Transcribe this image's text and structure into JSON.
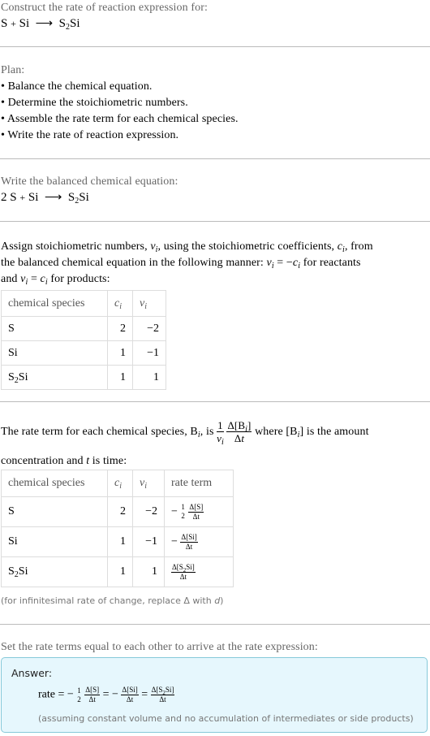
{
  "intro": {
    "prompt": "Construct the rate of reaction expression for:",
    "reaction": {
      "reactants": [
        "S",
        "Si"
      ],
      "arrow": "⟶",
      "product_base": "S",
      "product_sub": "2",
      "product_rest": "Si",
      "plus": "+"
    }
  },
  "plan": {
    "title": "Plan:",
    "items": [
      "• Balance the chemical equation.",
      "• Determine the stoichiometric numbers.",
      "• Assemble the rate term for each chemical species.",
      "• Write the rate of reaction expression."
    ]
  },
  "balanced": {
    "title": "Write the balanced chemical equation:",
    "coef": "2",
    "reactant1": "S",
    "plus": "+",
    "reactant2": "Si",
    "arrow": "⟶",
    "product_base": "S",
    "product_sub": "2",
    "product_rest": "Si"
  },
  "stoich": {
    "line1_a": "Assign stoichiometric numbers, ",
    "nu": "ν",
    "sub_i": "i",
    "line1_b": ", using the stoichiometric coefficients, ",
    "c": "c",
    "line1_c": ", from",
    "line2_a": "the balanced chemical equation in the following manner: ",
    "eq_neg": " = −",
    "line2_b": " for reactants",
    "line3_a": "and ",
    "eq": " = ",
    "line3_b": " for products:",
    "headers": [
      "chemical species",
      "c",
      "ν"
    ],
    "rows": [
      {
        "species": "S",
        "species_sub": "",
        "species_rest": "",
        "c": "2",
        "nu": "−2"
      },
      {
        "species": "Si",
        "species_sub": "",
        "species_rest": "",
        "c": "1",
        "nu": "−1"
      },
      {
        "species": "S",
        "species_sub": "2",
        "species_rest": "Si",
        "c": "1",
        "nu": "1"
      }
    ]
  },
  "rate_terms": {
    "line1_a": "The rate term for each chemical species, B",
    "line1_b": ", is ",
    "one": "1",
    "delta_B": "Δ[B",
    "delta_t": "Δ",
    "t": "t",
    "line1_c": " where [B",
    "line1_d": "] is the amount",
    "line2_a": "concentration and ",
    "line2_b": " is time:",
    "headers": [
      "chemical species",
      "c",
      "ν",
      "rate term"
    ],
    "rows": [
      {
        "species": "S",
        "species_sub": "",
        "species_rest": "",
        "c": "2",
        "nu": "−2",
        "sign": "−",
        "coef_n": "1",
        "coef_d": "2",
        "num": "Δ[S]",
        "den": "Δt"
      },
      {
        "species": "Si",
        "species_sub": "",
        "species_rest": "",
        "c": "1",
        "nu": "−1",
        "sign": "−",
        "num": "Δ[Si]",
        "den": "Δt"
      },
      {
        "species": "S",
        "species_sub": "2",
        "species_rest": "Si",
        "c": "1",
        "nu": "1",
        "sign": "",
        "num_a": "Δ[S",
        "num_sub": "2",
        "num_b": "Si]",
        "den": "Δt"
      }
    ],
    "note_a": "(for infinitesimal rate of change, replace Δ with ",
    "note_d": "d",
    "note_b": ")"
  },
  "final": {
    "title": "Set the rate terms equal to each other to arrive at the rate expression:",
    "answer_label": "Answer:",
    "rate": "rate",
    "eq": "=",
    "minus": "−",
    "one": "1",
    "two": "2",
    "dS": "Δ[S]",
    "dSi": "Δ[Si]",
    "dP_a": "Δ[S",
    "dP_sub": "2",
    "dP_b": "Si]",
    "dt": "Δt",
    "assumption": "(assuming constant volume and no accumulation of intermediates or side products)"
  }
}
